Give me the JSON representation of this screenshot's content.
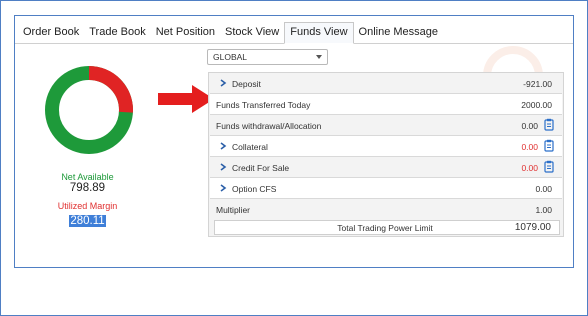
{
  "tabs": [
    {
      "label": "Order Book"
    },
    {
      "label": "Trade Book"
    },
    {
      "label": "Net Position"
    },
    {
      "label": "Stock View"
    },
    {
      "label": "Funds View",
      "active": true
    },
    {
      "label": "Online Message"
    }
  ],
  "segment_select": {
    "value": "GLOBAL"
  },
  "margin_summary": {
    "net_available_label": "Net Available",
    "net_available_value": "798.89",
    "utilized_margin_label": "Utilized Margin",
    "utilized_margin_value": "280.11",
    "colors": {
      "available": "#1e9a3a",
      "utilized": "#e02424"
    }
  },
  "funds": {
    "rows": [
      {
        "label": "Deposit",
        "value": "-921.00",
        "expandable": true
      },
      {
        "label": "Funds Transferred Today",
        "value": "2000.00",
        "expandable": false
      },
      {
        "label": "Funds withdrawal/Allocation",
        "value": "0.00",
        "expandable": false,
        "icon": "clipboard-icon"
      },
      {
        "label": "Collateral",
        "value": "0.00",
        "expandable": true,
        "icon": "clipboard-icon",
        "value_color": "#e03030"
      },
      {
        "label": "Credit For Sale",
        "value": "0.00",
        "expandable": true,
        "icon": "clipboard-icon",
        "value_color": "#e03030"
      },
      {
        "label": "Option CFS",
        "value": "0.00",
        "expandable": true
      },
      {
        "label": "Multiplier",
        "value": "1.00",
        "expandable": false
      }
    ],
    "total_label": "Total Trading Power Limit",
    "total_value": "1079.00"
  },
  "annotation": {
    "arrow_color": "#e41e1e",
    "icon": "red-arrow-icon"
  }
}
